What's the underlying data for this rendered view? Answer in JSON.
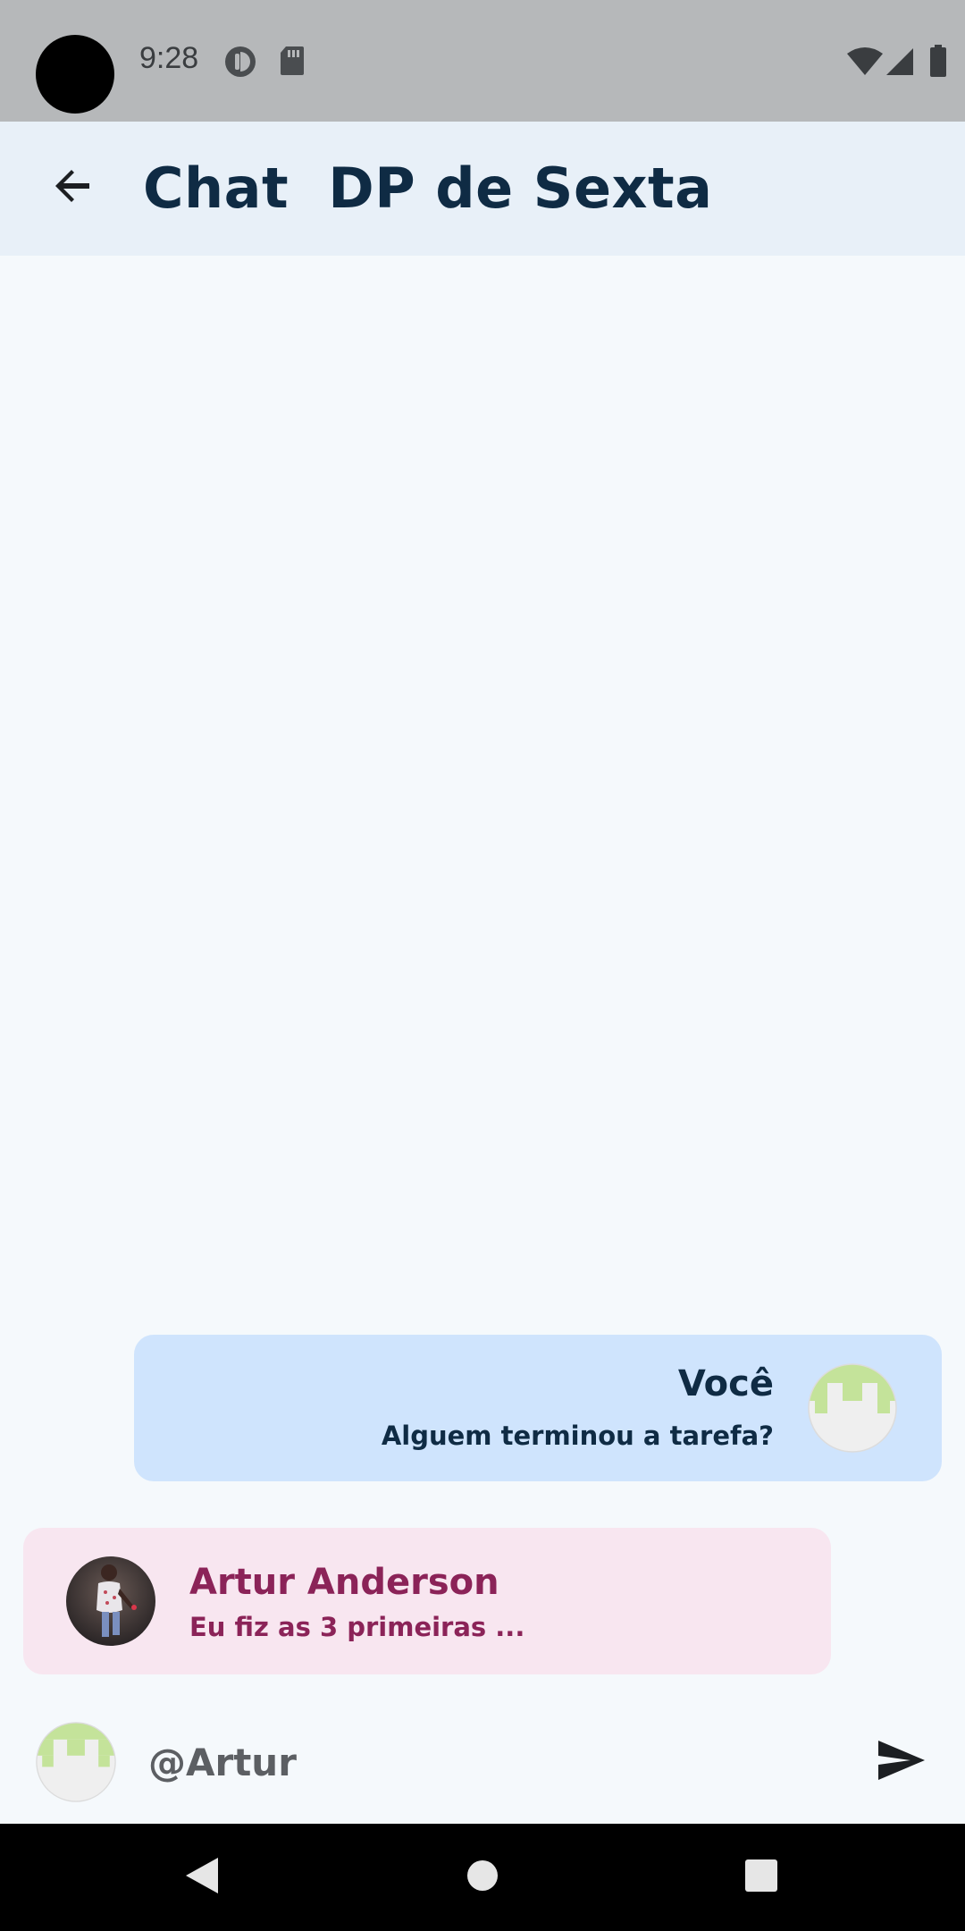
{
  "status_bar": {
    "time": "9:28",
    "left_icons": [
      "data-saver-icon",
      "sd-card-icon"
    ],
    "right_icons": [
      "wifi-icon",
      "cellular-signal-icon",
      "battery-icon"
    ]
  },
  "app_bar": {
    "back_icon": "arrow-back-icon",
    "title": "Chat  DP de Sexta"
  },
  "messages": [
    {
      "author": "Você",
      "text": "Alguem terminou a tarefa?",
      "avatar": "pixel-identicon-avatar",
      "is_self": true,
      "bubble_color": "#cfe4fd",
      "text_color": "#0f2b44"
    },
    {
      "author": "Artur Anderson",
      "text": "Eu fiz as 3 primeiras ...",
      "avatar": "photo-avatar",
      "is_self": false,
      "bubble_color": "#f8e6f0",
      "text_color": "#8b2358"
    }
  ],
  "composer": {
    "avatar": "pixel-identicon-avatar",
    "value": "@Artur",
    "send_icon": "send-icon"
  },
  "nav_bar": {
    "icons": [
      "back-triangle-icon",
      "home-circle-icon",
      "recents-square-icon"
    ]
  },
  "colors": {
    "status_bar": "#b6b8ba",
    "app_bar": "#e8f0f8",
    "background": "#f5f9fc",
    "title": "#0f2b44",
    "avatar_green": "#c4e39a"
  }
}
